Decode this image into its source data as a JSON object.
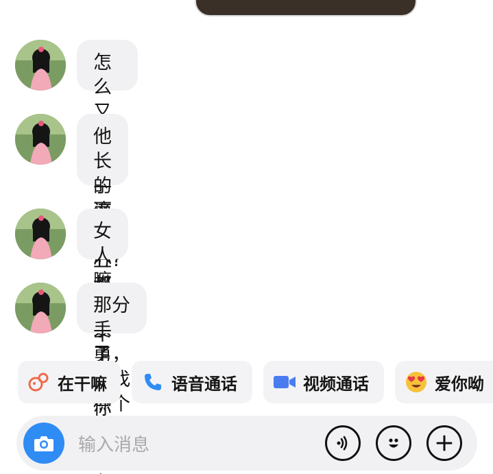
{
  "messages": [
    {
      "text": "怎么又会分手而伤心?"
    },
    {
      "text": "他长的这么丑都配不上你你还\n伤心个得啊"
    },
    {
      "text": "女人嘛就要勇敢点"
    },
    {
      "text": "那分手了，再找一个不就得了"
    }
  ],
  "quick_actions": [
    {
      "label": "在干嘛",
      "icon": "wave-emoji-icon"
    },
    {
      "label": "语音通话",
      "icon": "phone-icon"
    },
    {
      "label": "视频通话",
      "icon": "video-camera-icon"
    },
    {
      "label": "爱你呦",
      "icon": "heart-eyes-emoji-icon"
    }
  ],
  "input": {
    "placeholder": "输入消息"
  },
  "colors": {
    "bubble": "#f1f1f3",
    "accent": "#2f8cf5",
    "phone": "#2f8cf5",
    "video": "#4a7cf0"
  }
}
